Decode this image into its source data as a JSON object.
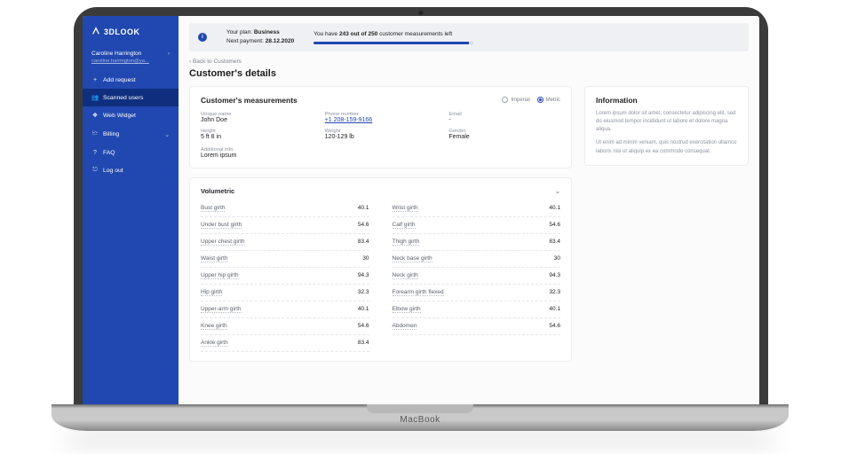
{
  "brand": "3DLOOK",
  "user": {
    "name": "Caroline Harrington",
    "email": "caroline.harrington@ya..."
  },
  "nav": {
    "add_request": "Add request",
    "scanned_users": "Scanned users",
    "web_widget": "Web Widget",
    "billing": "Billing",
    "faq": "FAQ",
    "logout": "Log out"
  },
  "topbar": {
    "plan_label": "Your plan:",
    "plan_value": "Business",
    "next_payment_label": "Next payment:",
    "next_payment_value": "28.12.2020",
    "quota_prefix": "You have",
    "quota_bold": "243 out of 250",
    "quota_suffix": "customer measurements left"
  },
  "breadcrumb": "‹  Back to Customers",
  "page_title": "Customer's details",
  "measurements_card_title": "Customer's measurements",
  "unit_toggle": {
    "imperial": "Imperial",
    "metric": "Metric",
    "selected": "metric"
  },
  "customer": {
    "unique_name_label": "Unique name",
    "unique_name": "John Doe",
    "phone_label": "Phone number",
    "phone": "+1 208-159-9166",
    "email_label": "Email",
    "email": "-",
    "height_label": "Height",
    "height": "5 ft  8 in",
    "weight_label": "Weight",
    "weight": "120-129 lb",
    "gender_label": "Gender",
    "gender": "Female",
    "additional_label": "Additional info",
    "additional": "Lorem ipsum"
  },
  "section_volumetric": "Volumetric",
  "meas_left": [
    {
      "label": "Bust girth",
      "value": "40.1"
    },
    {
      "label": "Under bust girth",
      "value": "54.6"
    },
    {
      "label": "Upper chest girth",
      "value": "83.4"
    },
    {
      "label": "Waist girth",
      "value": "30"
    },
    {
      "label": "Upper hip girth",
      "value": "94.3"
    },
    {
      "label": "Hip girth",
      "value": "32.3"
    },
    {
      "label": "Upper-arm girth",
      "value": "40.1"
    },
    {
      "label": "Knee girth",
      "value": "54.6"
    },
    {
      "label": "Ankle girth",
      "value": "83.4"
    }
  ],
  "meas_right": [
    {
      "label": "Wrist girth",
      "value": "40.1"
    },
    {
      "label": "Calf girth",
      "value": "54.6"
    },
    {
      "label": "Thigh girth",
      "value": "83.4"
    },
    {
      "label": "Neck base girth",
      "value": "30"
    },
    {
      "label": "Neck girth",
      "value": "94.3"
    },
    {
      "label": "Forearm girth flexed",
      "value": "32.3"
    },
    {
      "label": "Elbow girth",
      "value": "40.1"
    },
    {
      "label": "Abdomen",
      "value": "54.6"
    }
  ],
  "information": {
    "title": "Information",
    "p1": "Lorem ipsum dolor sit amet, consectetur adipiscing elit, sed do eiusmod tempor incididunt ut labore et dolore magna aliqua.",
    "p2": "Ut enim ad minim veniam, quis nostrud exercitation ullamco laboris nisi ut aliquip ex ea commodo consequat."
  },
  "macbook": "MacBook"
}
